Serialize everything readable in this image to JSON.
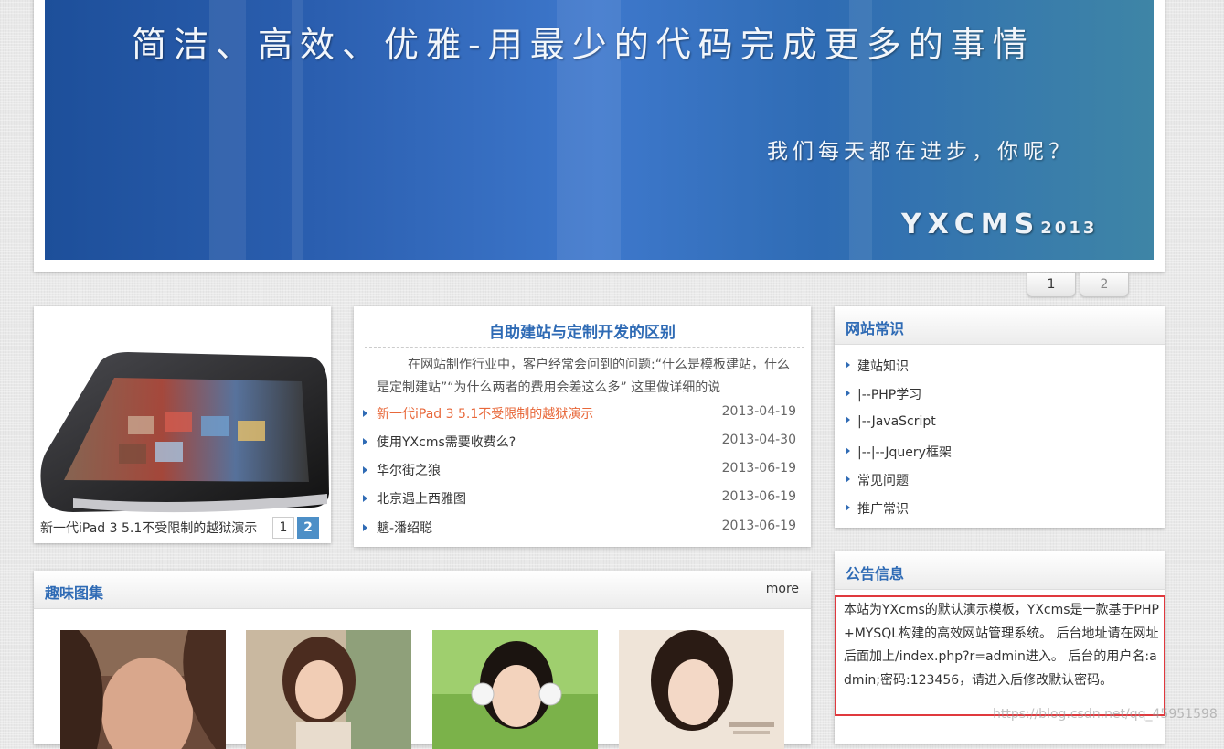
{
  "banner": {
    "headline": "简洁、高效、优雅-用最少的代码完成更多的事情",
    "tagline": "我们每天都在进步，你呢？",
    "brand": "YXCMS",
    "brand_year": "2013",
    "pager": [
      "1",
      "2"
    ]
  },
  "slider": {
    "caption": "新一代iPad 3 5.1不受限制的越狱演示",
    "pages": [
      "1",
      "2"
    ],
    "active_page": "2"
  },
  "article": {
    "title": "自助建站与定制开发的区别",
    "summary": "在网站制作行业中，客户经常会问到的问题:“什么是模板建站，什么是定制建站”“为什么两者的费用会差这么多” 这里做详细的说",
    "news": [
      {
        "title": "新一代iPad 3 5.1不受限制的越狱演示",
        "date": "2013-04-19",
        "active": true
      },
      {
        "title": "使用YXcms需要收费么?",
        "date": "2013-04-30"
      },
      {
        "title": "华尔街之狼",
        "date": "2013-06-19"
      },
      {
        "title": "北京遇上西雅图",
        "date": "2013-06-19"
      },
      {
        "title": "魑-潘绍聪",
        "date": "2013-06-19"
      }
    ]
  },
  "photos": {
    "title": "趣味图集",
    "more": "more"
  },
  "common": {
    "title": "网站常识",
    "items": [
      "建站知识",
      "|--PHP学习",
      "|--JavaScript",
      "|--|--Jquery框架",
      "常见问题",
      "推广常识"
    ]
  },
  "notice": {
    "title": "公告信息",
    "text": "本站为YXcms的默认演示模板，YXcms是一款基于PHP+MYSQL构建的高效网站管理系统。 后台地址请在网址后面加上/index.php?r=admin进入。 后台的用户名:admin;密码:123456，请进入后修改默认密码。"
  },
  "watermark": "https://blog.csdn.net/qq_45951598",
  "colors": {
    "accent": "#2f6bb5",
    "highlight": "#e8683a",
    "notice_border": "#e0393e"
  }
}
